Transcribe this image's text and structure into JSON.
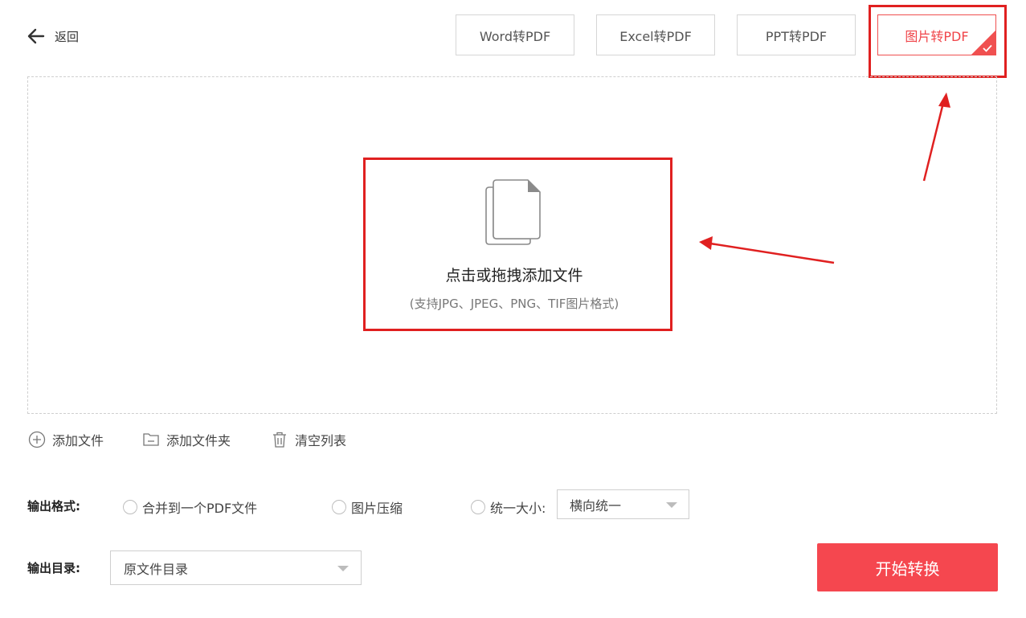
{
  "header": {
    "back_label": "返回",
    "tabs": [
      {
        "label": "Word转PDF",
        "active": false
      },
      {
        "label": "Excel转PDF",
        "active": false
      },
      {
        "label": "PPT转PDF",
        "active": false
      },
      {
        "label": "图片转PDF",
        "active": true
      }
    ]
  },
  "dropzone": {
    "title": "点击或拖拽添加文件",
    "hint": "(支持JPG、JPEG、PNG、TIF图片格式)"
  },
  "file_actions": {
    "add_file": "添加文件",
    "add_folder": "添加文件夹",
    "clear_list": "清空列表"
  },
  "output_format": {
    "label": "输出格式:",
    "options": [
      {
        "label": "合并到一个PDF文件",
        "checked": false
      },
      {
        "label": "图片压缩",
        "checked": false
      },
      {
        "label": "统一大小:",
        "checked": false
      }
    ],
    "size_select_value": "横向统一"
  },
  "output_dir": {
    "label": "输出目录:",
    "value": "原文件目录"
  },
  "start_button": "开始转换",
  "colors": {
    "accent": "#f5474f",
    "active_tab": "#f05050",
    "annotation": "#e02020"
  }
}
